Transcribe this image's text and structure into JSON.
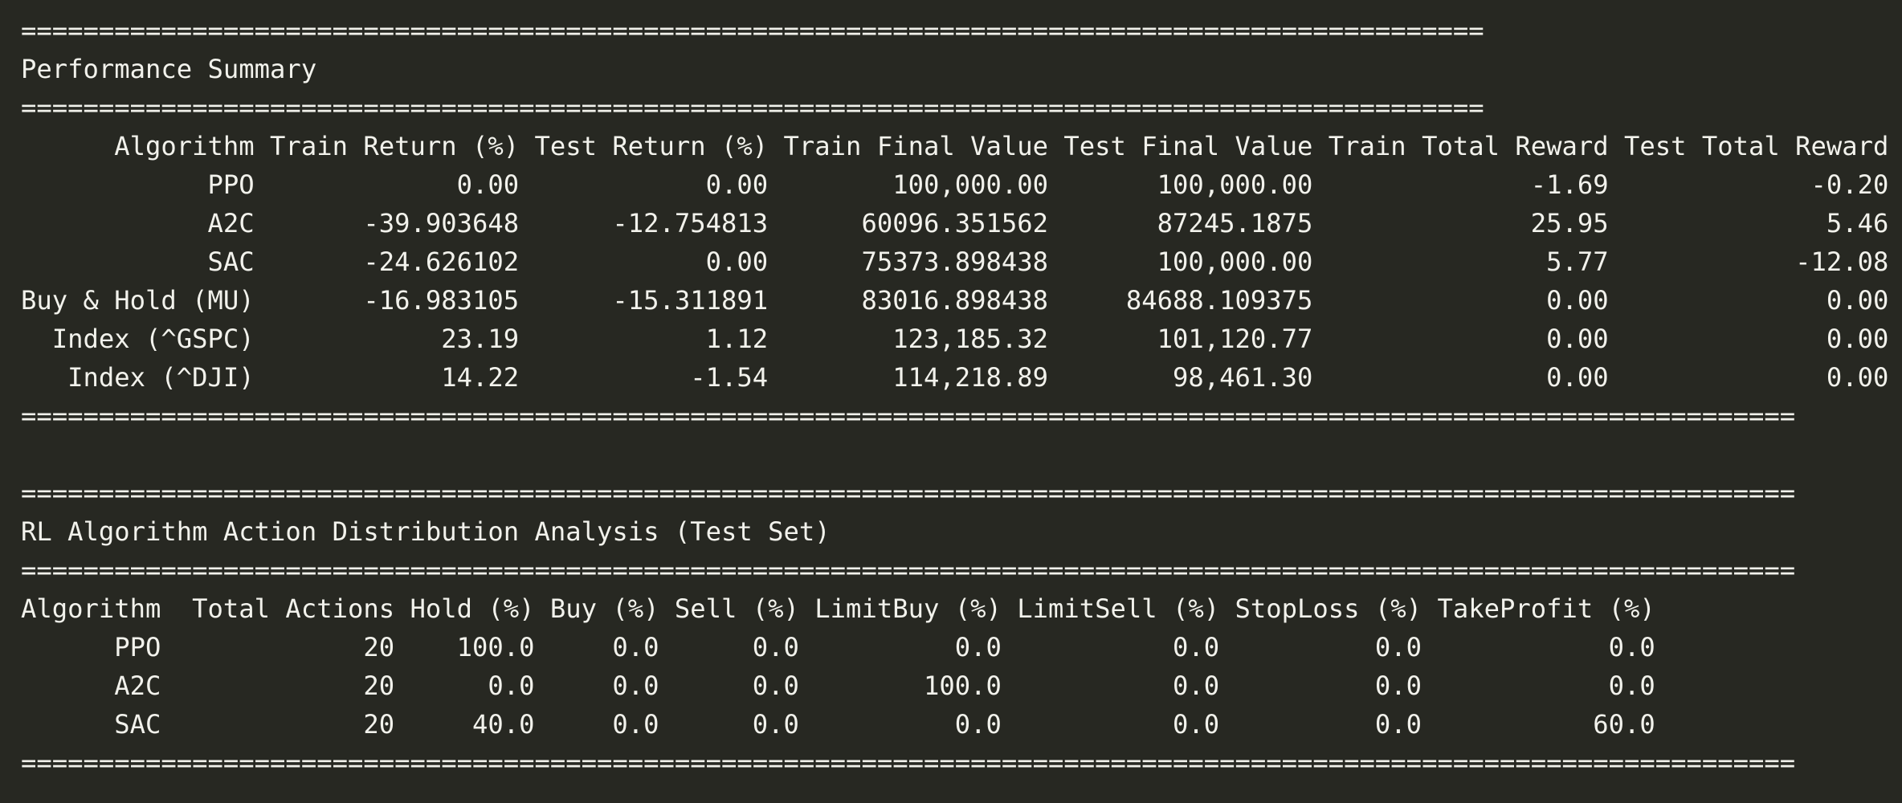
{
  "terminal": {
    "lines": [
      "==============================================================================================",
      "Performance Summary",
      "==============================================================================================",
      "      Algorithm Train Return (%) Test Return (%) Train Final Value Test Final Value Train Total Reward Test Total Reward",
      "            PPO             0.00            0.00        100,000.00       100,000.00              -1.69             -0.20",
      "            A2C       -39.903648      -12.754813      60096.351562       87245.1875              25.95              5.46",
      "            SAC       -24.626102            0.00      75373.898438       100,000.00               5.77            -12.08",
      "Buy & Hold (MU)       -16.983105      -15.311891      83016.898438     84688.109375               0.00              0.00",
      "  Index (^GSPC)            23.19            1.12        123,185.32       101,120.77               0.00              0.00",
      "   Index (^DJI)            14.22           -1.54        114,218.89        98,461.30               0.00              0.00",
      "==================================================================================================================",
      "",
      "==================================================================================================================",
      "RL Algorithm Action Distribution Analysis (Test Set)",
      "==================================================================================================================",
      "Algorithm  Total Actions Hold (%) Buy (%) Sell (%) LimitBuy (%) LimitSell (%) StopLoss (%) TakeProfit (%)",
      "      PPO             20    100.0     0.0      0.0          0.0           0.0          0.0            0.0",
      "      A2C             20      0.0     0.0      0.0        100.0           0.0          0.0            0.0",
      "      SAC             20     40.0     0.0      0.0          0.0           0.0          0.0           60.0",
      "=================================================================================================================="
    ]
  },
  "colors": {
    "background": "#272822",
    "foreground": "#f2f2ec"
  }
}
